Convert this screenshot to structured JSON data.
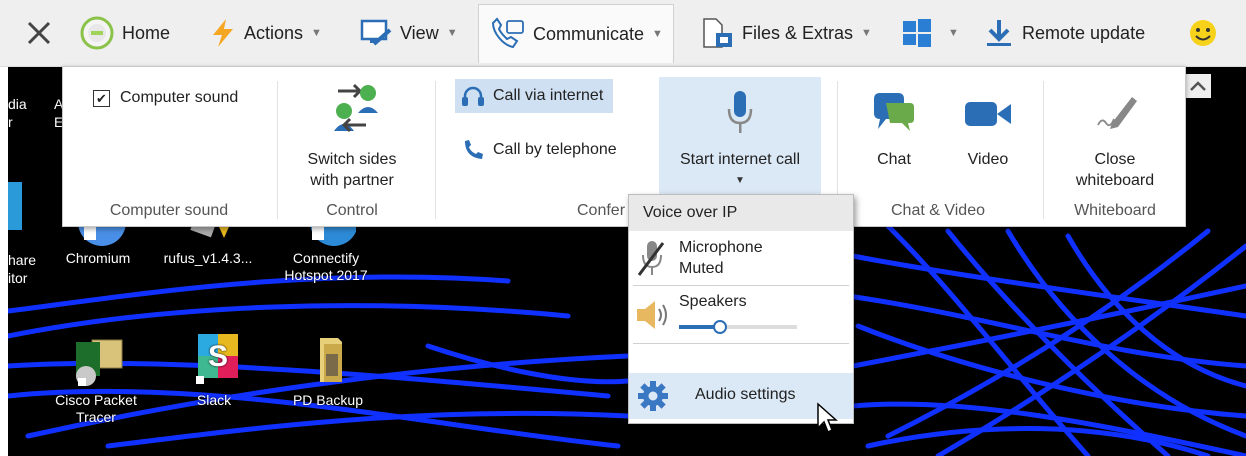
{
  "toolbar": {
    "home": "Home",
    "actions": "Actions",
    "view": "View",
    "communicate": "Communicate",
    "files": "Files & Extras",
    "remote_update": "Remote update"
  },
  "ribbon": {
    "computer_sound": {
      "checkbox_label": "Computer sound",
      "group": "Computer sound",
      "checked": true
    },
    "control": {
      "button_line1": "Switch sides",
      "button_line2": "with partner",
      "group": "Control"
    },
    "conference": {
      "call_internet": "Call via internet",
      "call_telephone": "Call by telephone",
      "start_call": "Start internet call",
      "group": "Confer"
    },
    "chat_video": {
      "chat": "Chat",
      "video": "Video",
      "group": "Chat & Video"
    },
    "whiteboard": {
      "line1": "Close",
      "line2": "whiteboard",
      "group": "Whiteboard"
    }
  },
  "dropdown": {
    "header": "Voice over IP",
    "mic_line1": "Microphone",
    "mic_line2": "Muted",
    "speakers": "Speakers",
    "speaker_level": 0.35,
    "audio_settings": "Audio settings"
  },
  "desktop": {
    "labels_row1": [
      "hare",
      "itor",
      "Chromium",
      "rufus_v1.4.3...",
      "Connectify",
      "Hotspot 2017"
    ],
    "labels_row2": [
      "Cisco Packet",
      "Tracer",
      "Slack",
      "PD Backup"
    ],
    "partial_top": [
      "dia",
      "r",
      "A",
      "E"
    ]
  },
  "colors": {
    "accent": "#3b78c4",
    "scribble": "#1030ff",
    "selected": "#cfe0f2",
    "hover": "#dbe8f6"
  }
}
